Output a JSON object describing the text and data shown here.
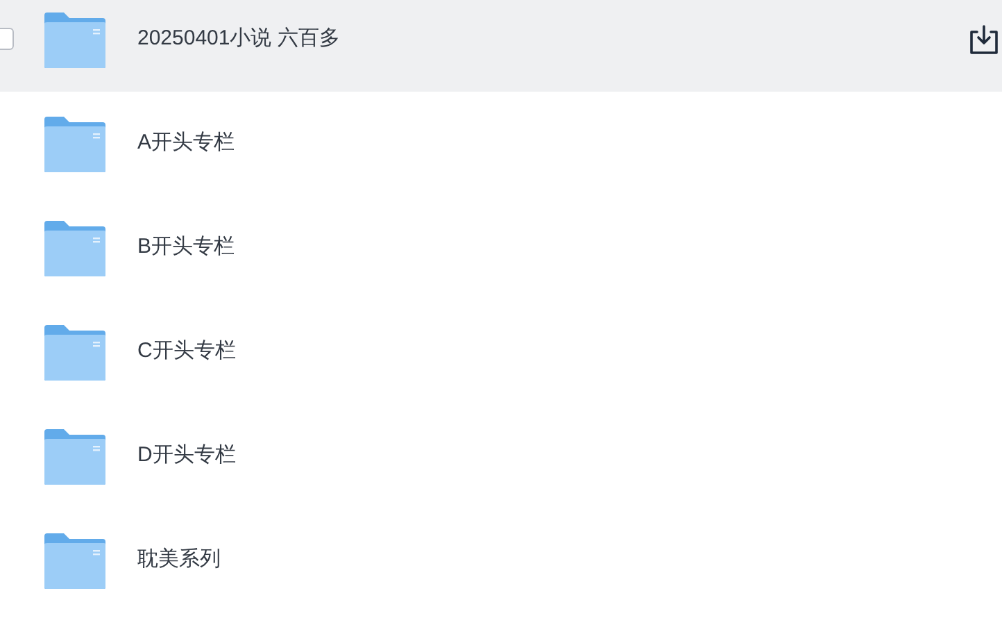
{
  "files": [
    {
      "name": "20250401小说 六百多",
      "hovered": true,
      "checked": false
    },
    {
      "name": "A开头专栏",
      "hovered": false
    },
    {
      "name": "B开头专栏",
      "hovered": false
    },
    {
      "name": "C开头专栏",
      "hovered": false
    },
    {
      "name": "D开头专栏",
      "hovered": false
    },
    {
      "name": "耽美系列",
      "hovered": false
    }
  ]
}
